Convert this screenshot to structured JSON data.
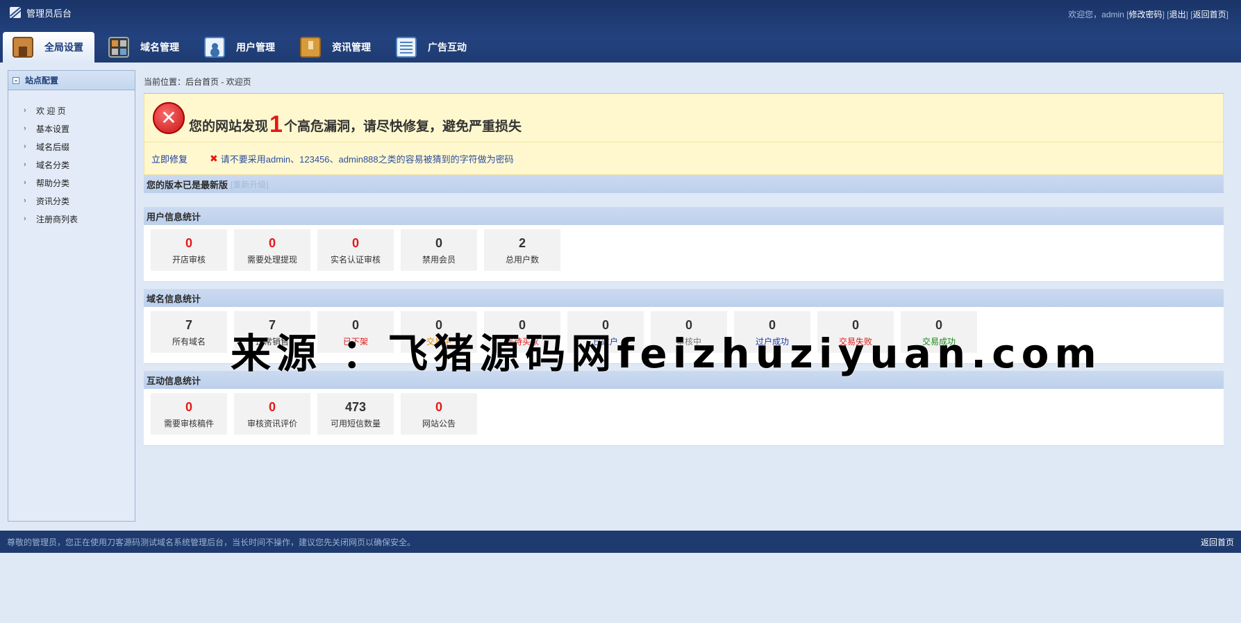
{
  "app": {
    "title": "管理员后台"
  },
  "top_links": {
    "welcome": "欢迎您，admin",
    "change_password": "修改密码",
    "logout": "退出",
    "home": "返回首页"
  },
  "nav": {
    "tabs": [
      {
        "label": "全局设置",
        "icon": "global-settings-icon",
        "active": true
      },
      {
        "label": "域名管理",
        "icon": "domain-grid-icon",
        "active": false
      },
      {
        "label": "用户管理",
        "icon": "user-card-icon",
        "active": false
      },
      {
        "label": "资讯管理",
        "icon": "news-folder-icon",
        "active": false
      },
      {
        "label": "广告互动",
        "icon": "ad-list-icon",
        "active": false
      }
    ]
  },
  "sidebar": {
    "title": "站点配置",
    "items": [
      {
        "label": "欢 迎 页"
      },
      {
        "label": "基本设置"
      },
      {
        "label": "域名后缀"
      },
      {
        "label": "域名分类"
      },
      {
        "label": "帮助分类"
      },
      {
        "label": "资讯分类"
      },
      {
        "label": "注册商列表"
      }
    ]
  },
  "main": {
    "breadcrumb": "当前位置：后台首页 - 欢迎页",
    "alert": {
      "prefix": "您的网站发现",
      "count": "1",
      "suffix": "个高危漏洞，请尽快修复，避免严重损失",
      "fix_link": "立即修复",
      "tip": "请不要采用admin、123456、admin888之类的容易被猜到的字符做为密码"
    },
    "version": {
      "text": "您的版本已是最新版",
      "upgrade": "[重新升级]"
    },
    "user_stats": {
      "title": "用户信息统计",
      "cards": [
        {
          "value": "0",
          "label": "开店审核",
          "color": "red"
        },
        {
          "value": "0",
          "label": "需要处理提现",
          "color": "red"
        },
        {
          "value": "0",
          "label": "实名认证审核",
          "color": "red"
        },
        {
          "value": "0",
          "label": "禁用会员",
          "color": "normal"
        },
        {
          "value": "2",
          "label": "总用户数",
          "color": "normal"
        }
      ]
    },
    "domain_stats": {
      "title": "域名信息统计",
      "cards": [
        {
          "value": "7",
          "label": "所有域名",
          "num_color": "normal",
          "label_color": "normal"
        },
        {
          "value": "7",
          "label": "正常销售",
          "num_color": "normal",
          "label_color": "normal"
        },
        {
          "value": "0",
          "label": "已下架",
          "num_color": "normal",
          "label_color": "red"
        },
        {
          "value": "0",
          "label": "交易中",
          "num_color": "normal",
          "label_color": "orange"
        },
        {
          "value": "0",
          "label": "等待买家",
          "num_color": "normal",
          "label_color": "red"
        },
        {
          "value": "0",
          "label": "已过户",
          "num_color": "normal",
          "label_color": "blue"
        },
        {
          "value": "0",
          "label": "审核中",
          "num_color": "normal",
          "label_color": "gray"
        },
        {
          "value": "0",
          "label": "过户成功",
          "num_color": "normal",
          "label_color": "blue"
        },
        {
          "value": "0",
          "label": "交易失败",
          "num_color": "normal",
          "label_color": "red"
        },
        {
          "value": "0",
          "label": "交易成功",
          "num_color": "normal",
          "label_color": "green"
        }
      ]
    },
    "interact_stats": {
      "title": "互动信息统计",
      "cards": [
        {
          "value": "0",
          "label": "需要审核稿件",
          "color": "red"
        },
        {
          "value": "0",
          "label": "审核资讯评价",
          "color": "red"
        },
        {
          "value": "473",
          "label": "可用短信数量",
          "color": "normal"
        },
        {
          "value": "0",
          "label": "网站公告",
          "color": "red"
        }
      ]
    }
  },
  "watermark": "来源 ：飞猪源码网feizhuziyuan.com",
  "footer": {
    "text": "尊敬的管理员，您正在使用刀客源码测试域名系统管理后台，当长时间不操作，建议您先关闭网页以确保安全。",
    "home_link": "返回首页"
  },
  "colors": {
    "header": "#1a3468",
    "accent_red": "#e31818",
    "link_blue": "#1a3aa0",
    "panel_bar": "#c3d6ef"
  }
}
